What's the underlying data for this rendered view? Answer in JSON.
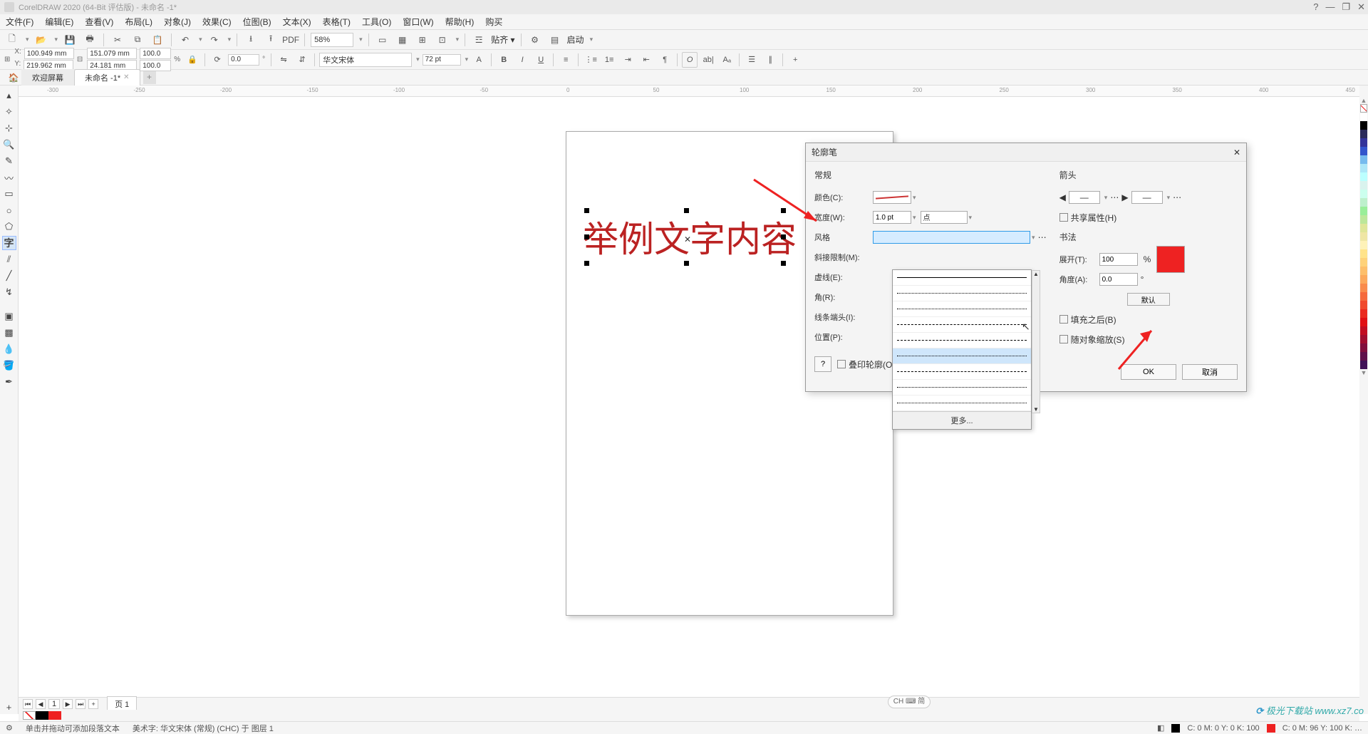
{
  "app": {
    "title": "CorelDRAW 2020 (64-Bit 评估版) - 未命名 -1*"
  },
  "menus": [
    "文件(F)",
    "编辑(E)",
    "查看(V)",
    "布局(L)",
    "对象(J)",
    "效果(C)",
    "位图(B)",
    "文本(X)",
    "表格(T)",
    "工具(O)",
    "窗口(W)",
    "帮助(H)",
    "购买"
  ],
  "toolbar": {
    "zoom": "58%",
    "launch": "启动"
  },
  "props": {
    "x": "100.949 mm",
    "y": "219.962 mm",
    "w": "151.079 mm",
    "h": "24.181 mm",
    "sx": "100.0",
    "sy": "100.0",
    "pct": "%",
    "rot": "0.0",
    "font": "华文宋体",
    "size": "72 pt"
  },
  "tabs": {
    "welcome": "欢迎屏幕",
    "doc": "未命名 -1*"
  },
  "canvas": {
    "text": "举例文字内容"
  },
  "dialog": {
    "title": "轮廓笔",
    "group_general": "常规",
    "lbl_color": "颜色(C):",
    "lbl_width": "宽度(W):",
    "width_val": "1.0 pt",
    "unit_val": "点",
    "lbl_style": "风格",
    "lbl_miter": "斜接限制(M):",
    "lbl_dash": "虚线(E):",
    "lbl_corner": "角(R):",
    "lbl_cap": "线条端头(I):",
    "lbl_pos": "位置(P):",
    "chk_overprint": "叠印轮廓(O)",
    "more": "更多...",
    "group_arrow": "箭头",
    "chk_share": "共享属性(H)",
    "group_callig": "书法",
    "lbl_spread": "展开(T):",
    "spread_val": "100",
    "pct": "%",
    "lbl_angle": "角度(A):",
    "angle_val": "0.0",
    "deg": "°",
    "btn_default": "默认",
    "chk_behind": "填充之后(B)",
    "chk_scale": "随对象缩放(S)",
    "btn_ok": "OK",
    "btn_cancel": "取消",
    "help": "?"
  },
  "paging": {
    "page": "页 1",
    "of": "1",
    "plus": "+"
  },
  "ime": "CH ⌨ 简",
  "status": {
    "hint": "单击并拖动可添加段落文本",
    "art": "美术字:  华文宋体 (常规) (CHC) 于 图层 1",
    "left_cmyk": "C:  0 M:  0 Y:  0 K: 100",
    "right_cmyk": "C:  0 M:  96 Y: 100 K:  …"
  },
  "watermark": "极光下载站  www.xz7.co",
  "palette": [
    "#ffffff",
    "#000000",
    "#2a2a5a",
    "#333399",
    "#3355cc",
    "#77bbee",
    "#aee7f8",
    "#bff",
    "#d9f3ee",
    "#cfe",
    "#bdf0cc",
    "#9e9",
    "#bce79a",
    "#dfe699",
    "#efe6a5",
    "#fef2b8",
    "#ffe38a",
    "#fed27a",
    "#fdbf6b",
    "#fca95c",
    "#f98b4c",
    "#f56a3c",
    "#f04a2d",
    "#ea2a1f",
    "#e10f14",
    "#c20d22",
    "#a10e30",
    "#810f3d",
    "#60104a",
    "#401157"
  ]
}
